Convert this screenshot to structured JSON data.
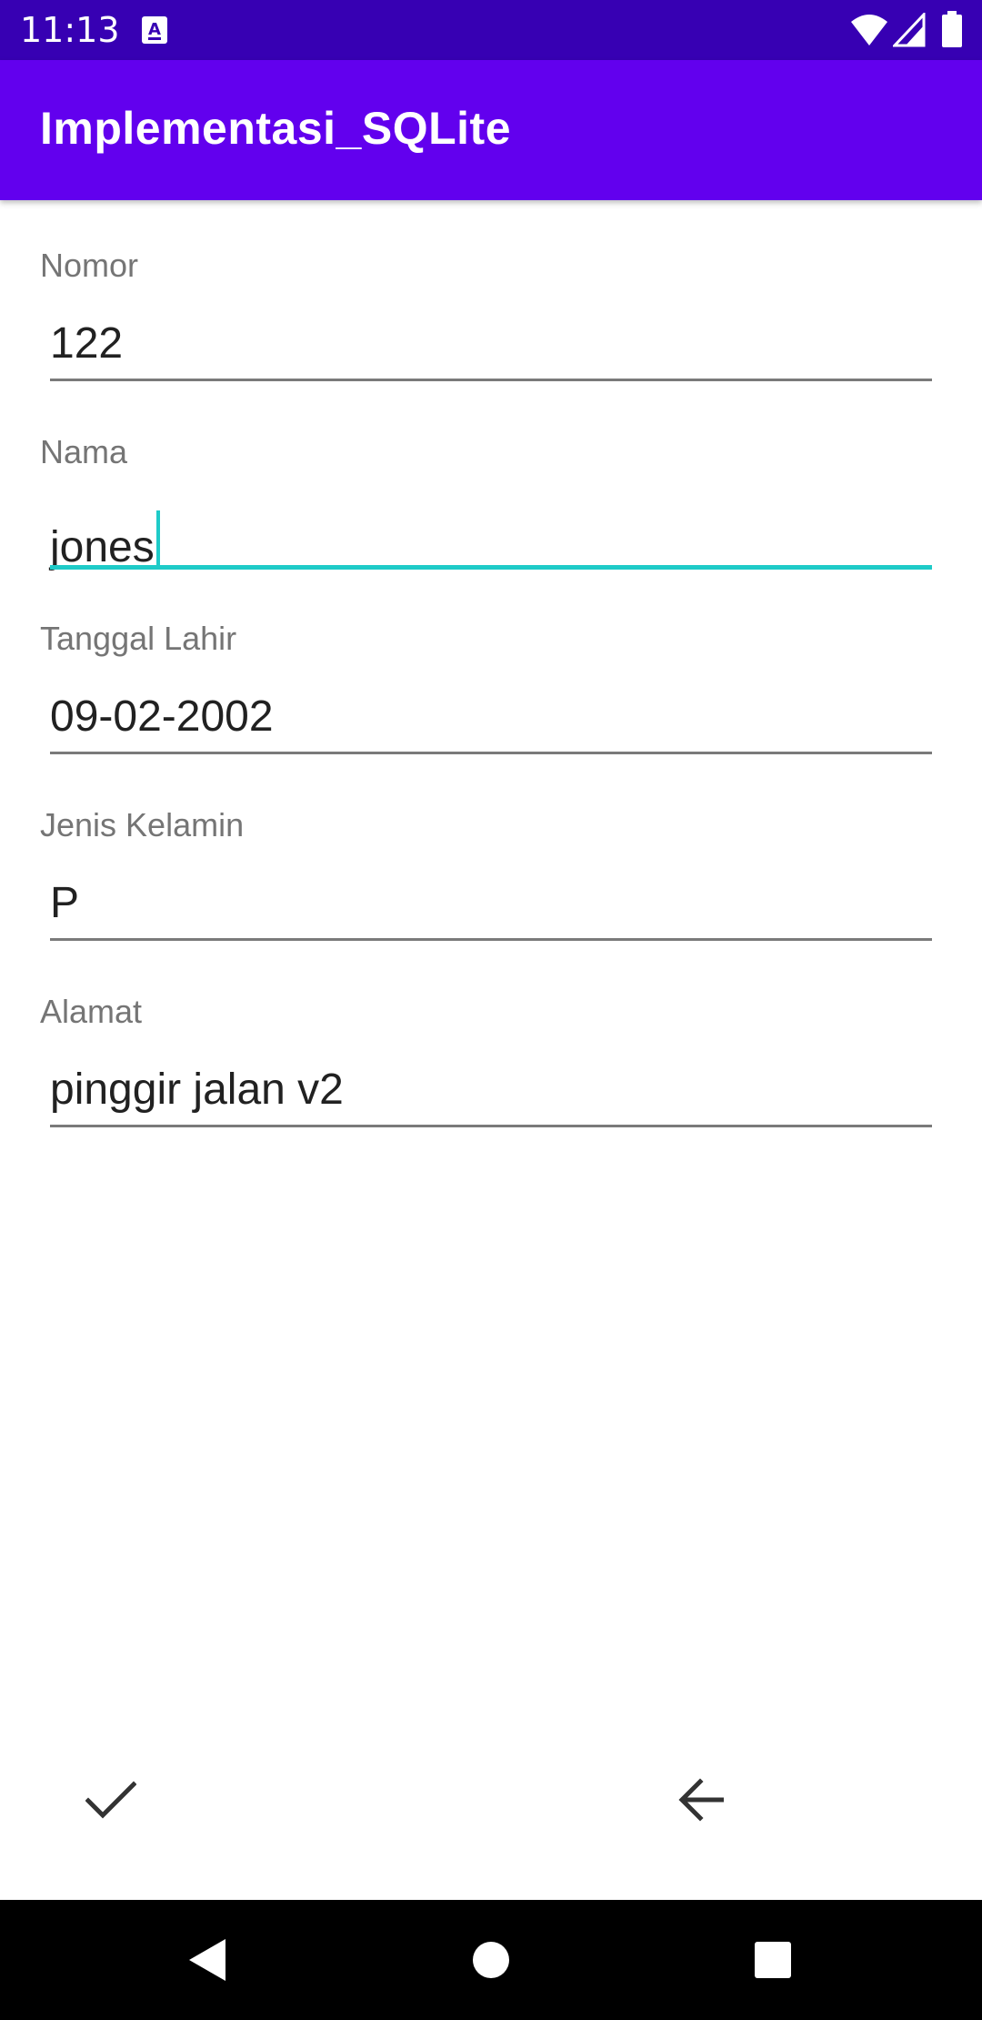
{
  "status_bar": {
    "time": "11:13",
    "notification_icon": "a-keyboard-icon",
    "wifi_icon": "wifi-icon",
    "signal_icon": "cell-signal-icon",
    "battery_icon": "battery-icon",
    "background_color": "#3700b3"
  },
  "app_bar": {
    "title": "Implementasi_SQLite",
    "background_color": "#6200ee"
  },
  "form": {
    "nomor": {
      "label": "Nomor",
      "value": "122"
    },
    "nama": {
      "label": "Nama",
      "value": "jones",
      "focused": true
    },
    "tanggal_lahir": {
      "label": "Tanggal Lahir",
      "value": "09-02-2002"
    },
    "jenis_kelamin": {
      "label": "Jenis Kelamin",
      "value": "P"
    },
    "alamat": {
      "label": "Alamat",
      "value": "pinggir jalan v2"
    },
    "focus_color": "#1ecbc8"
  },
  "actions": {
    "save_icon": "check-icon",
    "back_icon": "arrow-back-icon"
  },
  "nav_bar": {
    "back_icon": "nav-back-triangle-icon",
    "home_icon": "nav-home-circle-icon",
    "recents_icon": "nav-recents-square-icon"
  }
}
